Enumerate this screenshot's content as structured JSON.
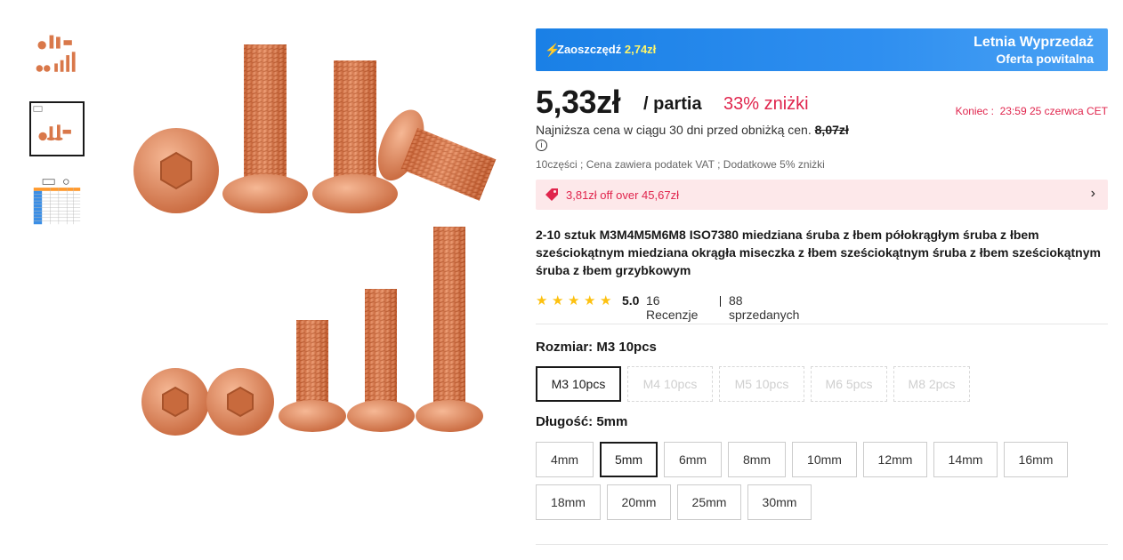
{
  "banner": {
    "savings_label": "Zaoszczędź",
    "savings_value": "2,74zł",
    "sale_title": "Letnia Wyprzedaż",
    "sale_subtitle": "Oferta powitalna"
  },
  "price": {
    "current": "5,33zł",
    "unit": "/ partia",
    "discount": "33% zniżki",
    "ends_label": "Koniec :",
    "ends_value": "23:59 25 czerwca CET",
    "lowest_text": "Najniższa cena w ciągu 30 dni przed obniżką cen.",
    "lowest_value": "8,07zł",
    "vat_text": "10części ; Cena zawiera podatek VAT ; Dodatkowe 5% zniżki"
  },
  "coupon": {
    "text": "3,81zł off over 45,67zł"
  },
  "product": {
    "title": "2-10 sztuk M3M4M5M6M8 ISO7380 miedziana śruba z łbem półokrągłym śruba z łbem sześciokątnym miedziana okrągła miseczka z łbem sześciokątnym śruba z łbem sześciokątnym śruba z łbem grzybkowym",
    "rating": "5.0",
    "reviews": "16 Recenzje",
    "sold": "88 sprzedanych"
  },
  "size": {
    "label": "Rozmiar: M3 10pcs",
    "options": [
      "M3 10pcs",
      "M4 10pcs",
      "M5 10pcs",
      "M6 5pcs",
      "M8 2pcs"
    ],
    "selected": "M3 10pcs"
  },
  "length": {
    "label": "Długość: 5mm",
    "options": [
      "4mm",
      "5mm",
      "6mm",
      "8mm",
      "10mm",
      "12mm",
      "14mm",
      "16mm",
      "18mm",
      "20mm",
      "25mm",
      "30mm"
    ],
    "selected": "5mm"
  },
  "colors": {
    "accent_red": "#e0254d",
    "banner_blue": "#1a80e6",
    "star": "#fdc110",
    "copper": "#d9784a"
  },
  "icons": [
    "lightning-icon",
    "info-icon",
    "coupon-tag-icon",
    "chevron-right-icon",
    "star-icon"
  ]
}
